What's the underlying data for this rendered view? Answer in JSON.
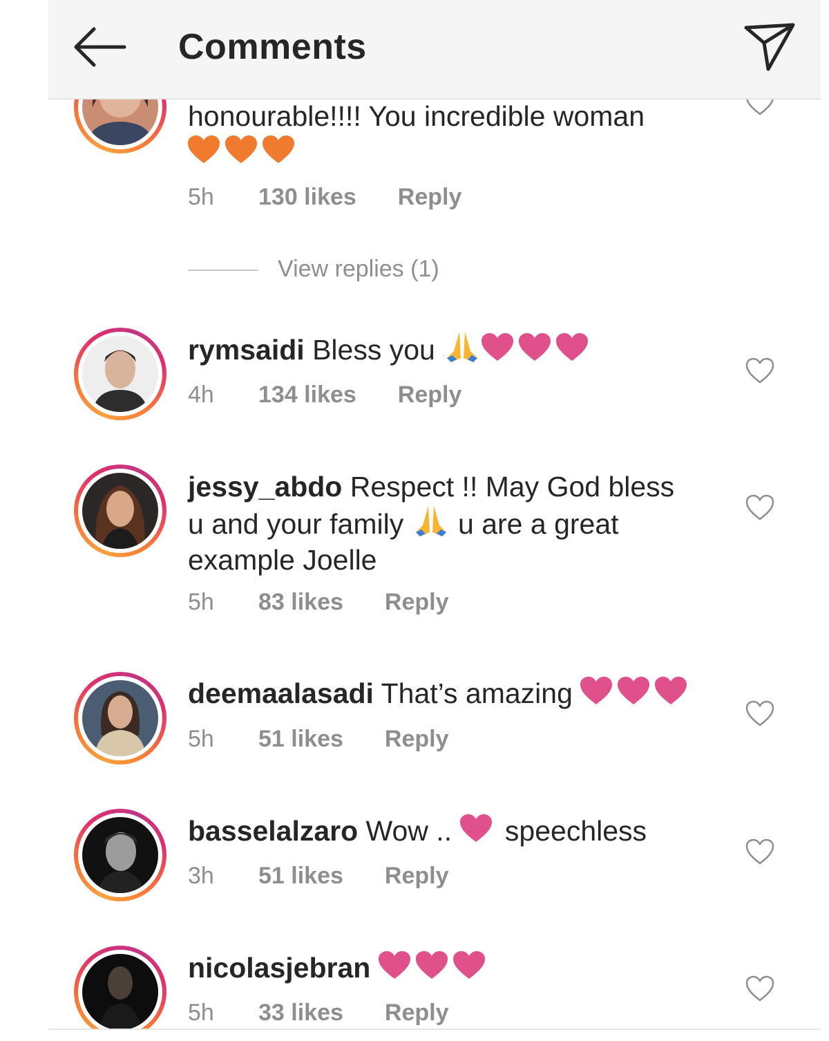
{
  "header": {
    "title": "Comments",
    "back_icon": "arrow-left-icon",
    "share_icon": "send-paper-plane-icon"
  },
  "colors": {
    "heart_orange": "#f07a2e",
    "heart_pink": "#e0508a",
    "ring_orange": "#f77737",
    "ring_pink": "#e1306c",
    "meta_gray": "#8e8e8e"
  },
  "comments": [
    {
      "text": "honourable!!!! You incredible woman",
      "emoji": "orange-heart-x3",
      "time": "5h",
      "likes": "130 likes",
      "reply": "Reply",
      "view_replies": "View replies (1)"
    },
    {
      "user": "rymsaidi",
      "text": "Bless you",
      "emoji": "folded-hands + pink-heart-x3",
      "time": "4h",
      "likes": "134 likes",
      "reply": "Reply"
    },
    {
      "user": "jessy_abdo",
      "text1": "Respect !! May God bless",
      "text2": "u and your family",
      "text3": "u are a great",
      "text4": "example Joelle",
      "emoji": "folded-hands",
      "time": "5h",
      "likes": "83 likes",
      "reply": "Reply"
    },
    {
      "user": "deemaalasadi",
      "text": "That’s amazing",
      "emoji": "pink-heart-x3",
      "time": "5h",
      "likes": "51 likes",
      "reply": "Reply"
    },
    {
      "user": "basselalzaro",
      "text1": "Wow ..",
      "text2": "speechless",
      "emoji": "pink-heart",
      "time": "3h",
      "likes": "51 likes",
      "reply": "Reply"
    },
    {
      "user": "nicolasjebran",
      "emoji": "pink-heart-x3",
      "time": "5h",
      "likes": "33 likes",
      "reply": "Reply"
    }
  ]
}
